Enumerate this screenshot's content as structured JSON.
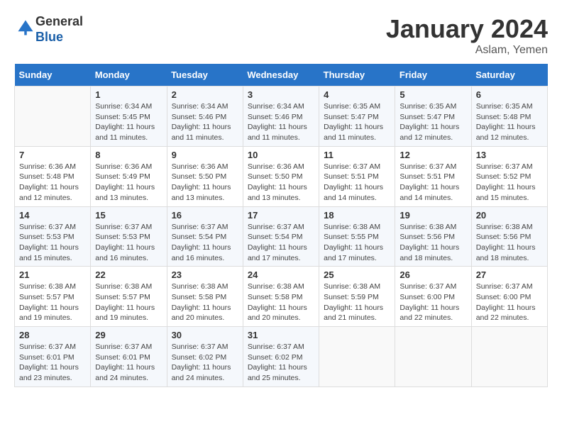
{
  "header": {
    "logo_line1": "General",
    "logo_line2": "Blue",
    "month": "January 2024",
    "location": "Aslam, Yemen"
  },
  "weekdays": [
    "Sunday",
    "Monday",
    "Tuesday",
    "Wednesday",
    "Thursday",
    "Friday",
    "Saturday"
  ],
  "weeks": [
    [
      {
        "day": "",
        "info": ""
      },
      {
        "day": "1",
        "info": "Sunrise: 6:34 AM\nSunset: 5:45 PM\nDaylight: 11 hours and 11 minutes."
      },
      {
        "day": "2",
        "info": "Sunrise: 6:34 AM\nSunset: 5:46 PM\nDaylight: 11 hours and 11 minutes."
      },
      {
        "day": "3",
        "info": "Sunrise: 6:34 AM\nSunset: 5:46 PM\nDaylight: 11 hours and 11 minutes."
      },
      {
        "day": "4",
        "info": "Sunrise: 6:35 AM\nSunset: 5:47 PM\nDaylight: 11 hours and 11 minutes."
      },
      {
        "day": "5",
        "info": "Sunrise: 6:35 AM\nSunset: 5:47 PM\nDaylight: 11 hours and 12 minutes."
      },
      {
        "day": "6",
        "info": "Sunrise: 6:35 AM\nSunset: 5:48 PM\nDaylight: 11 hours and 12 minutes."
      }
    ],
    [
      {
        "day": "7",
        "info": "Sunrise: 6:36 AM\nSunset: 5:48 PM\nDaylight: 11 hours and 12 minutes."
      },
      {
        "day": "8",
        "info": "Sunrise: 6:36 AM\nSunset: 5:49 PM\nDaylight: 11 hours and 13 minutes."
      },
      {
        "day": "9",
        "info": "Sunrise: 6:36 AM\nSunset: 5:50 PM\nDaylight: 11 hours and 13 minutes."
      },
      {
        "day": "10",
        "info": "Sunrise: 6:36 AM\nSunset: 5:50 PM\nDaylight: 11 hours and 13 minutes."
      },
      {
        "day": "11",
        "info": "Sunrise: 6:37 AM\nSunset: 5:51 PM\nDaylight: 11 hours and 14 minutes."
      },
      {
        "day": "12",
        "info": "Sunrise: 6:37 AM\nSunset: 5:51 PM\nDaylight: 11 hours and 14 minutes."
      },
      {
        "day": "13",
        "info": "Sunrise: 6:37 AM\nSunset: 5:52 PM\nDaylight: 11 hours and 15 minutes."
      }
    ],
    [
      {
        "day": "14",
        "info": "Sunrise: 6:37 AM\nSunset: 5:53 PM\nDaylight: 11 hours and 15 minutes."
      },
      {
        "day": "15",
        "info": "Sunrise: 6:37 AM\nSunset: 5:53 PM\nDaylight: 11 hours and 16 minutes."
      },
      {
        "day": "16",
        "info": "Sunrise: 6:37 AM\nSunset: 5:54 PM\nDaylight: 11 hours and 16 minutes."
      },
      {
        "day": "17",
        "info": "Sunrise: 6:37 AM\nSunset: 5:54 PM\nDaylight: 11 hours and 17 minutes."
      },
      {
        "day": "18",
        "info": "Sunrise: 6:38 AM\nSunset: 5:55 PM\nDaylight: 11 hours and 17 minutes."
      },
      {
        "day": "19",
        "info": "Sunrise: 6:38 AM\nSunset: 5:56 PM\nDaylight: 11 hours and 18 minutes."
      },
      {
        "day": "20",
        "info": "Sunrise: 6:38 AM\nSunset: 5:56 PM\nDaylight: 11 hours and 18 minutes."
      }
    ],
    [
      {
        "day": "21",
        "info": "Sunrise: 6:38 AM\nSunset: 5:57 PM\nDaylight: 11 hours and 19 minutes."
      },
      {
        "day": "22",
        "info": "Sunrise: 6:38 AM\nSunset: 5:57 PM\nDaylight: 11 hours and 19 minutes."
      },
      {
        "day": "23",
        "info": "Sunrise: 6:38 AM\nSunset: 5:58 PM\nDaylight: 11 hours and 20 minutes."
      },
      {
        "day": "24",
        "info": "Sunrise: 6:38 AM\nSunset: 5:58 PM\nDaylight: 11 hours and 20 minutes."
      },
      {
        "day": "25",
        "info": "Sunrise: 6:38 AM\nSunset: 5:59 PM\nDaylight: 11 hours and 21 minutes."
      },
      {
        "day": "26",
        "info": "Sunrise: 6:37 AM\nSunset: 6:00 PM\nDaylight: 11 hours and 22 minutes."
      },
      {
        "day": "27",
        "info": "Sunrise: 6:37 AM\nSunset: 6:00 PM\nDaylight: 11 hours and 22 minutes."
      }
    ],
    [
      {
        "day": "28",
        "info": "Sunrise: 6:37 AM\nSunset: 6:01 PM\nDaylight: 11 hours and 23 minutes."
      },
      {
        "day": "29",
        "info": "Sunrise: 6:37 AM\nSunset: 6:01 PM\nDaylight: 11 hours and 24 minutes."
      },
      {
        "day": "30",
        "info": "Sunrise: 6:37 AM\nSunset: 6:02 PM\nDaylight: 11 hours and 24 minutes."
      },
      {
        "day": "31",
        "info": "Sunrise: 6:37 AM\nSunset: 6:02 PM\nDaylight: 11 hours and 25 minutes."
      },
      {
        "day": "",
        "info": ""
      },
      {
        "day": "",
        "info": ""
      },
      {
        "day": "",
        "info": ""
      }
    ]
  ]
}
